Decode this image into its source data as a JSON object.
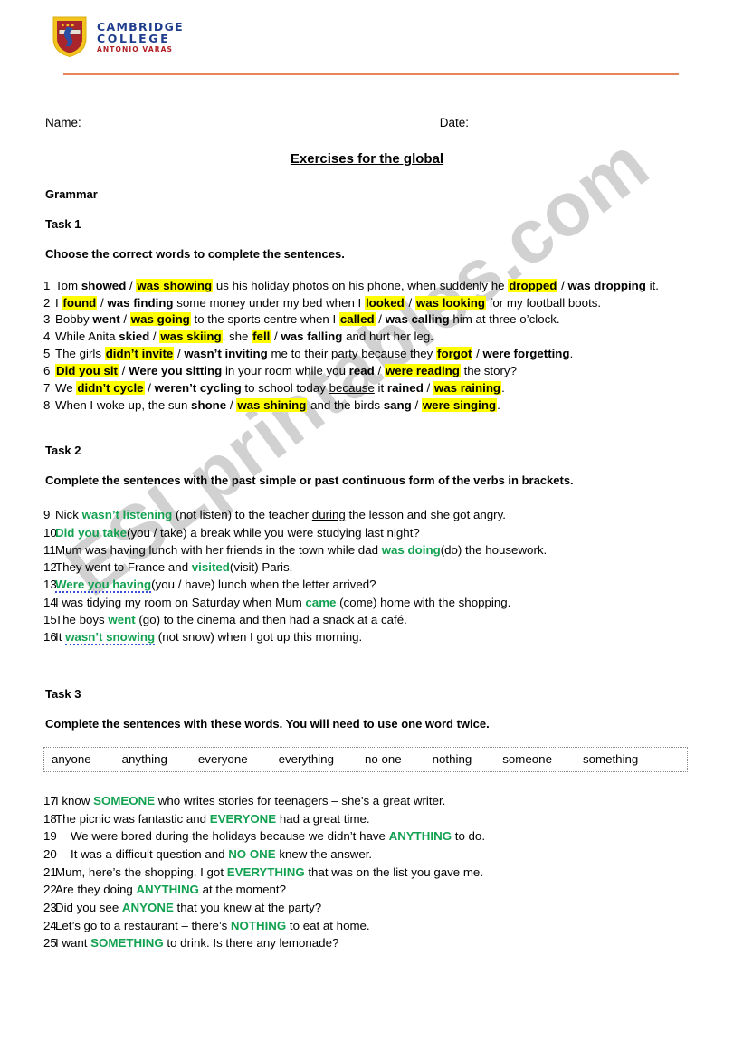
{
  "logo": {
    "icon": "shield-crest-icon",
    "line1": "CAMBRIDGE",
    "line2": "COLLEGE",
    "line3": "ANTONIO VARAS",
    "brand_blue": "#1f3d8c",
    "brand_red": "#b01f24",
    "rule_color": "#e8845a"
  },
  "watermark": {
    "text": "ESLprintables.com",
    "color": "#c9c9c9"
  },
  "header": {
    "name_label": "Name:",
    "date_label": "Date:"
  },
  "title": "Exercises for the global",
  "grammar_label": "Grammar",
  "colors": {
    "highlight": "#ffff00",
    "answer_green": "#12a150",
    "spellcheck_underline": "#3b4fd8"
  },
  "task1": {
    "heading": "Task 1",
    "instruction": "Choose the correct words to complete the sentences.",
    "items": [
      {
        "num": "1",
        "parts": [
          {
            "t": "Tom ",
            "s": "plain"
          },
          {
            "t": "showed",
            "s": "bold"
          },
          {
            "t": " / ",
            "s": "plain"
          },
          {
            "t": "was showing",
            "s": "hl"
          },
          {
            "t": " us his holiday photos on his phone, when suddenly he ",
            "s": "plain"
          },
          {
            "t": "dropped",
            "s": "hl"
          },
          {
            "t": " / ",
            "s": "plain"
          },
          {
            "t": "was dropping",
            "s": "bold"
          },
          {
            "t": " it.",
            "s": "plain"
          }
        ]
      },
      {
        "num": "2",
        "parts": [
          {
            "t": "I ",
            "s": "plain"
          },
          {
            "t": "found",
            "s": "hl"
          },
          {
            "t": " / ",
            "s": "plain"
          },
          {
            "t": "was finding",
            "s": "bold"
          },
          {
            "t": " some money under my bed when I ",
            "s": "plain"
          },
          {
            "t": "looked",
            "s": "hl"
          },
          {
            "t": " / ",
            "s": "plain"
          },
          {
            "t": "was looking",
            "s": "hl"
          },
          {
            "t": " for my football boots.",
            "s": "plain"
          }
        ]
      },
      {
        "num": "3",
        "parts": [
          {
            "t": "Bobby ",
            "s": "plain"
          },
          {
            "t": "went",
            "s": "bold"
          },
          {
            "t": " / ",
            "s": "plain"
          },
          {
            "t": "was going",
            "s": "hl"
          },
          {
            "t": " to the sports centre when I ",
            "s": "plain"
          },
          {
            "t": "called",
            "s": "hl"
          },
          {
            "t": " / ",
            "s": "plain"
          },
          {
            "t": "was calling",
            "s": "bold"
          },
          {
            "t": " him at three o’clock.",
            "s": "plain"
          }
        ]
      },
      {
        "num": "4",
        "parts": [
          {
            "t": "While Anita ",
            "s": "plain"
          },
          {
            "t": "skied",
            "s": "bold"
          },
          {
            "t": " / ",
            "s": "plain"
          },
          {
            "t": "was skiing",
            "s": "hl"
          },
          {
            "t": ", she ",
            "s": "plain"
          },
          {
            "t": "fell",
            "s": "hl"
          },
          {
            "t": " / ",
            "s": "plain"
          },
          {
            "t": "was falling",
            "s": "bold"
          },
          {
            "t": " and hurt her leg.",
            "s": "plain"
          }
        ]
      },
      {
        "num": "5",
        "parts": [
          {
            "t": "The girls ",
            "s": "plain"
          },
          {
            "t": "didn’t invite",
            "s": "hl"
          },
          {
            "t": " / ",
            "s": "plain"
          },
          {
            "t": "wasn’t inviting",
            "s": "bold"
          },
          {
            "t": " me to their party because they ",
            "s": "plain"
          },
          {
            "t": "forgot",
            "s": "hl"
          },
          {
            "t": " / ",
            "s": "plain"
          },
          {
            "t": "were forgetting",
            "s": "bold"
          },
          {
            "t": ".",
            "s": "plain"
          }
        ]
      },
      {
        "num": "6",
        "parts": [
          {
            "t": "Did you sit",
            "s": "hl"
          },
          {
            "t": " / ",
            "s": "plain"
          },
          {
            "t": "Were you sitting",
            "s": "bold"
          },
          {
            "t": " in your room while you ",
            "s": "plain"
          },
          {
            "t": "read",
            "s": "bold"
          },
          {
            "t": " / ",
            "s": "plain"
          },
          {
            "t": "were reading",
            "s": "hl"
          },
          {
            "t": " the story?",
            "s": "plain"
          }
        ]
      },
      {
        "num": "7",
        "parts": [
          {
            "t": "We ",
            "s": "plain"
          },
          {
            "t": "didn’t cycle",
            "s": "hl"
          },
          {
            "t": " / ",
            "s": "plain"
          },
          {
            "t": "weren’t cycling",
            "s": "bold"
          },
          {
            "t": " to school today ",
            "s": "plain"
          },
          {
            "t": "because",
            "s": "underline"
          },
          {
            "t": " it ",
            "s": "plain"
          },
          {
            "t": "rained",
            "s": "bold"
          },
          {
            "t": " / ",
            "s": "plain"
          },
          {
            "t": "was raining",
            "s": "hl"
          },
          {
            "t": ".",
            "s": "plain"
          }
        ]
      },
      {
        "num": "8",
        "parts": [
          {
            "t": "When I woke up, the sun ",
            "s": "plain"
          },
          {
            "t": "shone",
            "s": "bold"
          },
          {
            "t": " / ",
            "s": "plain"
          },
          {
            "t": "was shining",
            "s": "hl"
          },
          {
            "t": " and the birds ",
            "s": "plain"
          },
          {
            "t": "sang",
            "s": "bold"
          },
          {
            "t": " / ",
            "s": "plain"
          },
          {
            "t": "were singing",
            "s": "hl"
          },
          {
            "t": ".",
            "s": "plain"
          }
        ]
      }
    ]
  },
  "task2": {
    "heading": "Task 2",
    "instruction": "Complete the sentences with the past simple or past continuous form of the verbs in brackets.",
    "items": [
      {
        "num": "9",
        "parts": [
          {
            "t": "Nick ",
            "s": "plain"
          },
          {
            "t": "wasn’t listening",
            "s": "green"
          },
          {
            "t": " (not listen) to the teacher ",
            "s": "plain"
          },
          {
            "t": "during",
            "s": "underline"
          },
          {
            "t": " the lesson and she got angry.",
            "s": "plain"
          }
        ]
      },
      {
        "num": "10",
        "parts": [
          {
            "t": "Did you take",
            "s": "green"
          },
          {
            "t": "(you / take) a break while you were studying last night?",
            "s": "plain"
          }
        ]
      },
      {
        "num": "11",
        "parts": [
          {
            "t": "Mum was having lunch with her friends in the town while dad ",
            "s": "plain"
          },
          {
            "t": "was doing",
            "s": "green"
          },
          {
            "t": "(do) the housework.",
            "s": "plain"
          }
        ]
      },
      {
        "num": "12",
        "parts": [
          {
            "t": "They went to France and ",
            "s": "plain"
          },
          {
            "t": "visited",
            "s": "green"
          },
          {
            "t": "(visit) Paris.",
            "s": "plain"
          }
        ]
      },
      {
        "num": "13",
        "parts": [
          {
            "t": "Were you having",
            "s": "green-sp"
          },
          {
            "t": "(you / have) lunch when the letter arrived?",
            "s": "plain"
          }
        ]
      },
      {
        "num": "14",
        "parts": [
          {
            "t": "I was tidying my room on Saturday when Mum ",
            "s": "plain"
          },
          {
            "t": "came",
            "s": "green"
          },
          {
            "t": " (come) home with the shopping.",
            "s": "plain"
          }
        ]
      },
      {
        "num": "15",
        "parts": [
          {
            "t": "The boys ",
            "s": "plain"
          },
          {
            "t": "went",
            "s": "green"
          },
          {
            "t": " (go) to the cinema and then had a snack at a café.",
            "s": "plain"
          }
        ]
      },
      {
        "num": "16",
        "parts": [
          {
            "t": "It ",
            "s": "plain"
          },
          {
            "t": "wasn’t snowing",
            "s": "green-sp"
          },
          {
            "t": " (not snow) when I got up this morning.",
            "s": "plain"
          }
        ]
      }
    ]
  },
  "task3": {
    "heading": "Task 3",
    "instruction": "Complete the sentences with these words. You will need to use one word twice.",
    "wordbank": [
      "anyone",
      "anything",
      "everyone",
      "everything",
      "no one",
      "nothing",
      "someone",
      "something"
    ],
    "items": [
      {
        "num": "17",
        "wide": false,
        "parts": [
          {
            "t": "I know ",
            "s": "plain"
          },
          {
            "t": "SOMEONE",
            "s": "green"
          },
          {
            "t": " who writes stories for teenagers – she’s a great writer.",
            "s": "plain"
          }
        ]
      },
      {
        "num": "18",
        "wide": false,
        "parts": [
          {
            "t": "The picnic was fantastic and ",
            "s": "plain"
          },
          {
            "t": "EVERYONE",
            "s": "green"
          },
          {
            "t": " had a great time.",
            "s": "plain"
          }
        ]
      },
      {
        "num": "19",
        "wide": true,
        "parts": [
          {
            "t": "We were bored during the holidays because we didn’t have ",
            "s": "plain"
          },
          {
            "t": "ANYTHING",
            "s": "green"
          },
          {
            "t": " to do.",
            "s": "plain"
          }
        ]
      },
      {
        "num": "20",
        "wide": true,
        "parts": [
          {
            "t": "It was a difficult question and ",
            "s": "plain"
          },
          {
            "t": "NO ONE",
            "s": "green"
          },
          {
            "t": " knew the answer.",
            "s": "plain"
          }
        ]
      },
      {
        "num": "21",
        "wide": false,
        "parts": [
          {
            "t": "Mum, here’s the shopping. I got ",
            "s": "plain"
          },
          {
            "t": "EVERYTHING",
            "s": "green"
          },
          {
            "t": " that was on the list you gave me.",
            "s": "plain"
          }
        ]
      },
      {
        "num": "22",
        "wide": false,
        "parts": [
          {
            "t": "Are they doing ",
            "s": "plain"
          },
          {
            "t": "ANYTHING",
            "s": "green"
          },
          {
            "t": "  at the moment?",
            "s": "plain"
          }
        ]
      },
      {
        "num": "23",
        "wide": false,
        "parts": [
          {
            "t": "Did you see ",
            "s": "plain"
          },
          {
            "t": "ANYONE",
            "s": "green"
          },
          {
            "t": " that you knew at the party?",
            "s": "plain"
          }
        ]
      },
      {
        "num": "24",
        "wide": false,
        "parts": [
          {
            "t": "Let’s go to a restaurant – there’s ",
            "s": "plain"
          },
          {
            "t": "NOTHING",
            "s": "green"
          },
          {
            "t": " to eat at home.",
            "s": "plain"
          }
        ]
      },
      {
        "num": "25",
        "wide": false,
        "parts": [
          {
            "t": "I want ",
            "s": "plain"
          },
          {
            "t": "SOMETHING",
            "s": "green"
          },
          {
            "t": " to drink. Is there any lemonade?",
            "s": "plain"
          }
        ]
      }
    ]
  }
}
